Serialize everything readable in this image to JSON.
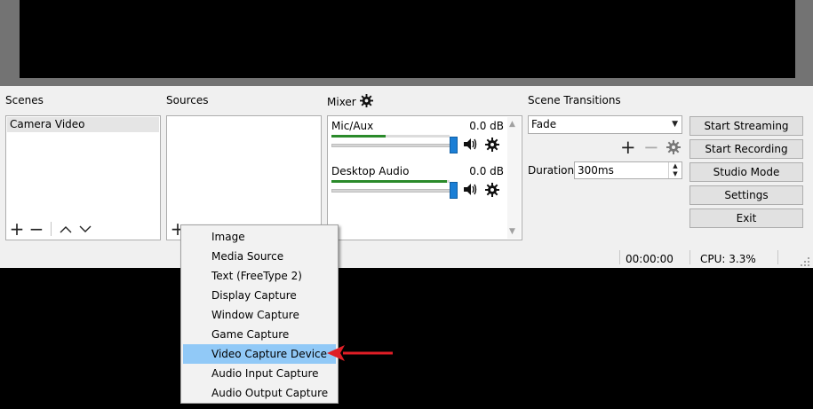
{
  "panels": {
    "scenes_title": "Scenes",
    "sources_title": "Sources",
    "mixer_title": "Mixer",
    "transitions_title": "Scene Transitions"
  },
  "scenes": {
    "items": [
      "Camera Video"
    ]
  },
  "mixer": {
    "tracks": [
      {
        "name": "Mic/Aux",
        "db": "0.0 dB",
        "level": 0.46
      },
      {
        "name": "Desktop Audio",
        "db": "0.0 dB",
        "level": 0.98
      }
    ]
  },
  "transitions": {
    "selected": "Fade",
    "duration_label": "Duration",
    "duration_value": "300ms"
  },
  "controls": {
    "start_streaming": "Start Streaming",
    "start_recording": "Start Recording",
    "studio_mode": "Studio Mode",
    "settings": "Settings",
    "exit": "Exit"
  },
  "status": {
    "time": "00:00:00",
    "cpu": "CPU: 3.3%"
  },
  "context_menu": {
    "items": [
      "Image",
      "Media Source",
      "Text (FreeType 2)",
      "Display Capture",
      "Window Capture",
      "Game Capture",
      "Video Capture Device",
      "Audio Input Capture",
      "Audio Output Capture"
    ],
    "highlighted": "Video Capture Device"
  },
  "colors": {
    "highlight": "#91c9f7",
    "arrow": "#e01e26",
    "meter": "#2a8a2a",
    "slider": "#1b7fd6"
  }
}
